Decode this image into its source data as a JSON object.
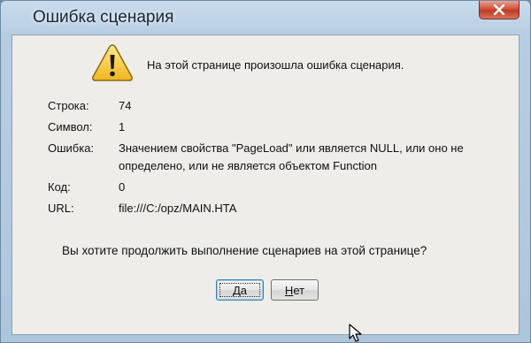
{
  "window": {
    "title": "Ошибка сценария",
    "close_label": "✕"
  },
  "message": "На этой странице произошла ошибка сценария.",
  "details": [
    {
      "label": "Строка:",
      "value": "74"
    },
    {
      "label": "Символ:",
      "value": "1"
    },
    {
      "label": "Ошибка:",
      "value": "Значением свойства \"PageLoad\" или является NULL, или оно не определено, или не является объектом Function"
    },
    {
      "label": "Код:",
      "value": "0"
    },
    {
      "label": "URL:",
      "value": "file:///C:/opz/MAIN.HTA"
    }
  ],
  "question": "Вы хотите продолжить выполнение сценариев на этой странице?",
  "buttons": {
    "yes_mnemonic": "Д",
    "yes_rest": "а",
    "no_mnemonic": "Н",
    "no_rest": "ет"
  },
  "icons": {
    "warning": "warning-icon",
    "close": "close-icon",
    "cursor": "mouse-cursor-icon"
  },
  "colors": {
    "title_bar": "#b7cde2",
    "close_button": "#c03a24",
    "client_bg": "#eeedea",
    "warning_yellow": "#f4c430"
  }
}
